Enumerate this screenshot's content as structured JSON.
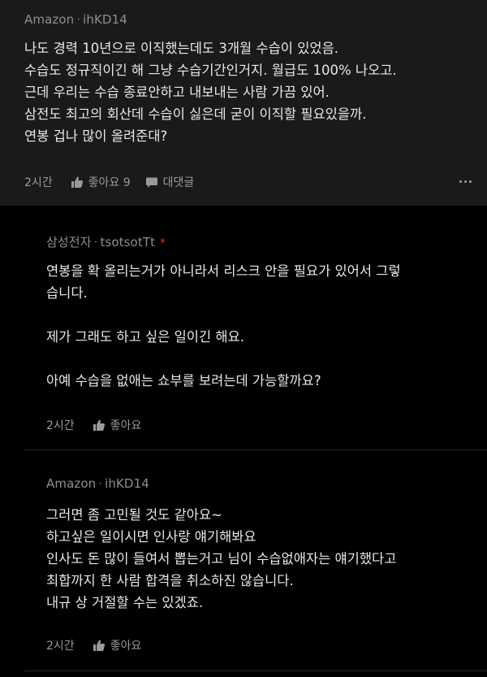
{
  "post": {
    "company": "Amazon",
    "handle": "ihKD14",
    "lines": [
      "나도 경력 10년으로 이직했는데도 3개월 수습이 있었음.",
      "수습도 정규직이긴 해 그냥 수습기간인거지. 월급도 100% 나오고.",
      "근데 우리는 수습 종료안하고 내보내는 사람 가끔 있어.",
      "삼전도 최고의 회산데 수습이 싫은데 굳이 이직할 필요있을까.",
      "연봉 겁나 많이 올려준대?"
    ],
    "time": "2시간",
    "like_label": "좋아요 9",
    "reply_label": "대댓글"
  },
  "replies": [
    {
      "company": "삼성전자",
      "handle": "tsotsotTt",
      "author_mark": "*",
      "lines": [
        "연봉을 확 올리는거가 아니라서 리스크 안을 필요가 있어서 그렇",
        "습니다.",
        "",
        "제가 그래도 하고 싶은 일이긴 해요.",
        "",
        "아예 수습을 없애는 쇼부를 보려는데 가능할까요?"
      ],
      "time": "2시간",
      "like_label": "좋아요"
    },
    {
      "company": "Amazon",
      "handle": "ihKD14",
      "lines": [
        "그러면 좀 고민될 것도 같아요~",
        "하고싶은 일이시면 인사랑 얘기해봐요",
        "인사도 돈 많이 들여서 뽑는거고 님이 수습없애자는 얘기했다고",
        "최합까지 한 사람 합격을 취소하진 않습니다.",
        "내규 상 거절할 수는 있겠죠."
      ],
      "time": "2시간",
      "like_label": "좋아요"
    }
  ],
  "icons": {
    "like": "thumbs-up-icon",
    "reply": "chat-bubble-icon",
    "more": "more-dots-icon"
  },
  "colors": {
    "background": "#000000",
    "post_background": "#1a1a1a",
    "text": "#e8e8e8",
    "muted": "#8e8e8e",
    "op_marker": "#ff2e2e"
  }
}
